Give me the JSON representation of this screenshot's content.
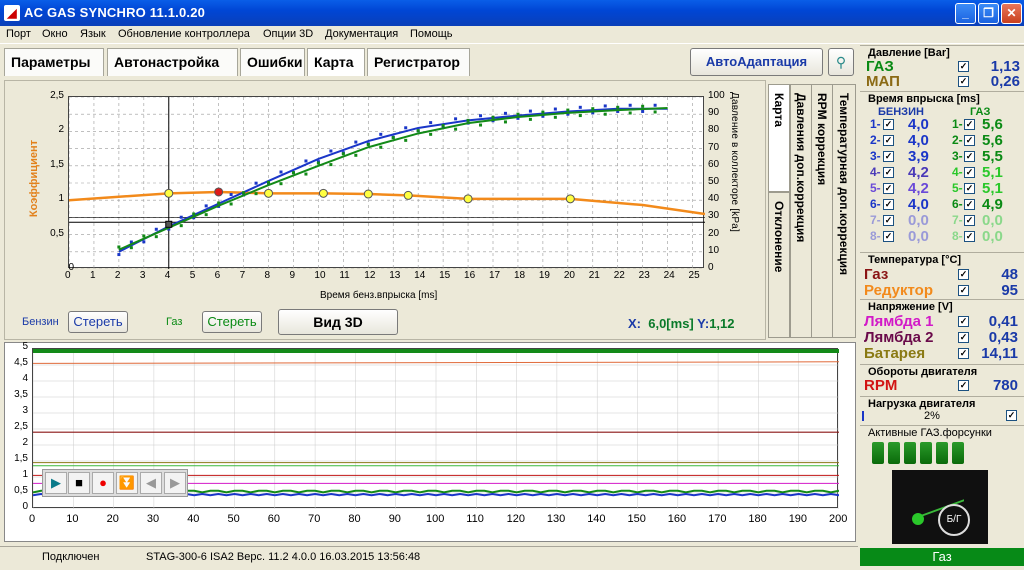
{
  "window": {
    "title": "AC GAS SYNCHRO  11.1.0.20"
  },
  "menu": [
    "Порт",
    "Окно",
    "Язык",
    "Обновление контроллера",
    "Опции 3D",
    "Документация",
    "Помощь"
  ],
  "tabs": [
    "Параметры",
    "Автонастройка",
    "Ошибки",
    "Карта",
    "Регистратор"
  ],
  "autoadapt": "АвтоАдаптация",
  "side_tabs": [
    "Карта",
    "Отклонение",
    "Давления доп.коррекция",
    "RPM коррекция",
    "Температурная доп.коррекция"
  ],
  "map": {
    "y_axis_left_label": "Коэффициент",
    "y_axis_right_label": "Давление в коллекторе [kPa]",
    "x_axis_label": "Время бенз.впрыска [ms]",
    "x_ticks": [
      "0",
      "1",
      "2",
      "3",
      "4",
      "5",
      "6",
      "7",
      "8",
      "9",
      "10",
      "11",
      "12",
      "13",
      "14",
      "15",
      "16",
      "17",
      "18",
      "19",
      "20",
      "21",
      "22",
      "23",
      "24",
      "25"
    ],
    "y_left_ticks": [
      "0",
      "0,5",
      "1",
      "1,5",
      "2",
      "2,5"
    ],
    "y_right_ticks": [
      "0",
      "10",
      "20",
      "30",
      "40",
      "50",
      "60",
      "70",
      "80",
      "90",
      "100"
    ],
    "cursor_x": "X:",
    "cursor_x_val": "6,0[ms]",
    "cursor_y": "Y:",
    "cursor_y_val": "1,12",
    "petrol_label": "Бензин",
    "petrol_clear": "Стереть",
    "gas_label": "Газ",
    "gas_clear": "Стереть",
    "view3d": "Вид 3D"
  },
  "chart_data": [
    {
      "type": "line",
      "title": "Карта",
      "xlabel": "Время бенз.впрыска [ms]",
      "ylabel": "Коэффициент",
      "xlim": [
        0,
        25.5
      ],
      "ylim": [
        0,
        2.5
      ],
      "y2lim": [
        0,
        100
      ],
      "series": [
        {
          "name": "",
          "values": [
            [
              0,
              1.0
            ],
            [
              4,
              1.1
            ],
            [
              6,
              1.12
            ],
            [
              8,
              1.1
            ],
            [
              10.2,
              1.1
            ],
            [
              12,
              1.09
            ],
            [
              13.6,
              1.07
            ],
            [
              16,
              1.02
            ],
            [
              20.1,
              1.02
            ],
            [
              23,
              0.93
            ],
            [
              25.5,
              0.8
            ]
          ]
        },
        {
          "name": "Бензин",
          "axis": "right",
          "values": [
            [
              2,
              0.25
            ],
            [
              4,
              0.62
            ],
            [
              6,
              0.95
            ],
            [
              8,
              1.28
            ],
            [
              10,
              1.6
            ],
            [
              12,
              1.86
            ],
            [
              14,
              2.05
            ],
            [
              16,
              2.16
            ],
            [
              18,
              2.23
            ],
            [
              20,
              2.29
            ],
            [
              22,
              2.33
            ],
            [
              24,
              2.33
            ]
          ]
        },
        {
          "name": "Газ",
          "axis": "right",
          "values": [
            [
              2,
              0.28
            ],
            [
              4,
              0.6
            ],
            [
              6,
              0.92
            ],
            [
              8,
              1.22
            ],
            [
              10,
              1.5
            ],
            [
              12,
              1.77
            ],
            [
              14,
              1.97
            ],
            [
              16,
              2.12
            ],
            [
              18,
              2.21
            ],
            [
              20,
              2.27
            ],
            [
              22,
              2.31
            ],
            [
              24,
              2.34
            ]
          ]
        }
      ]
    },
    {
      "type": "line",
      "title": "Регистратор",
      "xlim": [
        0,
        200
      ],
      "ylim": [
        0,
        5
      ],
      "x_ticks": [
        "0",
        "10",
        "20",
        "30",
        "40",
        "50",
        "60",
        "70",
        "80",
        "90",
        "100",
        "110",
        "120",
        "130",
        "140",
        "150",
        "160",
        "170",
        "180",
        "190",
        "200"
      ],
      "y_ticks": [
        "0",
        "0,5",
        "1",
        "1,5",
        "2",
        "2,5",
        "3",
        "3,5",
        "4",
        "4,5",
        "5"
      ]
    }
  ],
  "pressure": {
    "header": "Давление [Bar]",
    "gas_label": "ГАЗ",
    "gas": "1,13",
    "map_label": "МАП",
    "map": "0,26"
  },
  "injection": {
    "header": "Время впрыска [ms]",
    "petrol_label": "БЕНЗИН",
    "gas_label": "ГАЗ",
    "petrol": [
      [
        "1-",
        "4,0"
      ],
      [
        "2-",
        "4,0"
      ],
      [
        "3-",
        "3,9"
      ],
      [
        "4-",
        "4,2"
      ],
      [
        "5-",
        "4,2"
      ],
      [
        "6-",
        "4,0"
      ],
      [
        "7-",
        "0,0"
      ],
      [
        "8-",
        "0,0"
      ]
    ],
    "gas": [
      [
        "1-",
        "5,6"
      ],
      [
        "2-",
        "5,6"
      ],
      [
        "3-",
        "5,5"
      ],
      [
        "4-",
        "5,1"
      ],
      [
        "5-",
        "5,1"
      ],
      [
        "6-",
        "4,9"
      ],
      [
        "7-",
        "0,0"
      ],
      [
        "8-",
        "0,0"
      ]
    ]
  },
  "temperature": {
    "header": "Температура  [°C]",
    "gas_label": "Газ",
    "gas": "48",
    "reducer_label": "Редуктор",
    "reducer": "95"
  },
  "voltage": {
    "header": "Напряжение [V]",
    "l1_label": "Лямбда 1",
    "l1": "0,41",
    "l2_label": "Лямбда 2",
    "l2": "0,43",
    "bat_label": "Батарея",
    "bat": "14,11"
  },
  "rpm": {
    "header": "Обороты двигателя",
    "label": "RPM",
    "value": "780"
  },
  "load": {
    "header": "Нагрузка двигателя",
    "value": "2%"
  },
  "injectors": {
    "header": "Активные ГАЗ.форсунки",
    "switch_label": "Б/Г"
  },
  "status": {
    "connected": "Подключен",
    "device": "STAG-300-6 ISA2  Верс. 11.2  4.0.0    16.03.2015 13:56:48",
    "mode": "Газ"
  },
  "colors": {
    "title": "#0046d5",
    "gas_green": "#078a17",
    "orange": "#f28a1b",
    "blue_series": "#1a36c8",
    "green_series": "#138a18"
  }
}
